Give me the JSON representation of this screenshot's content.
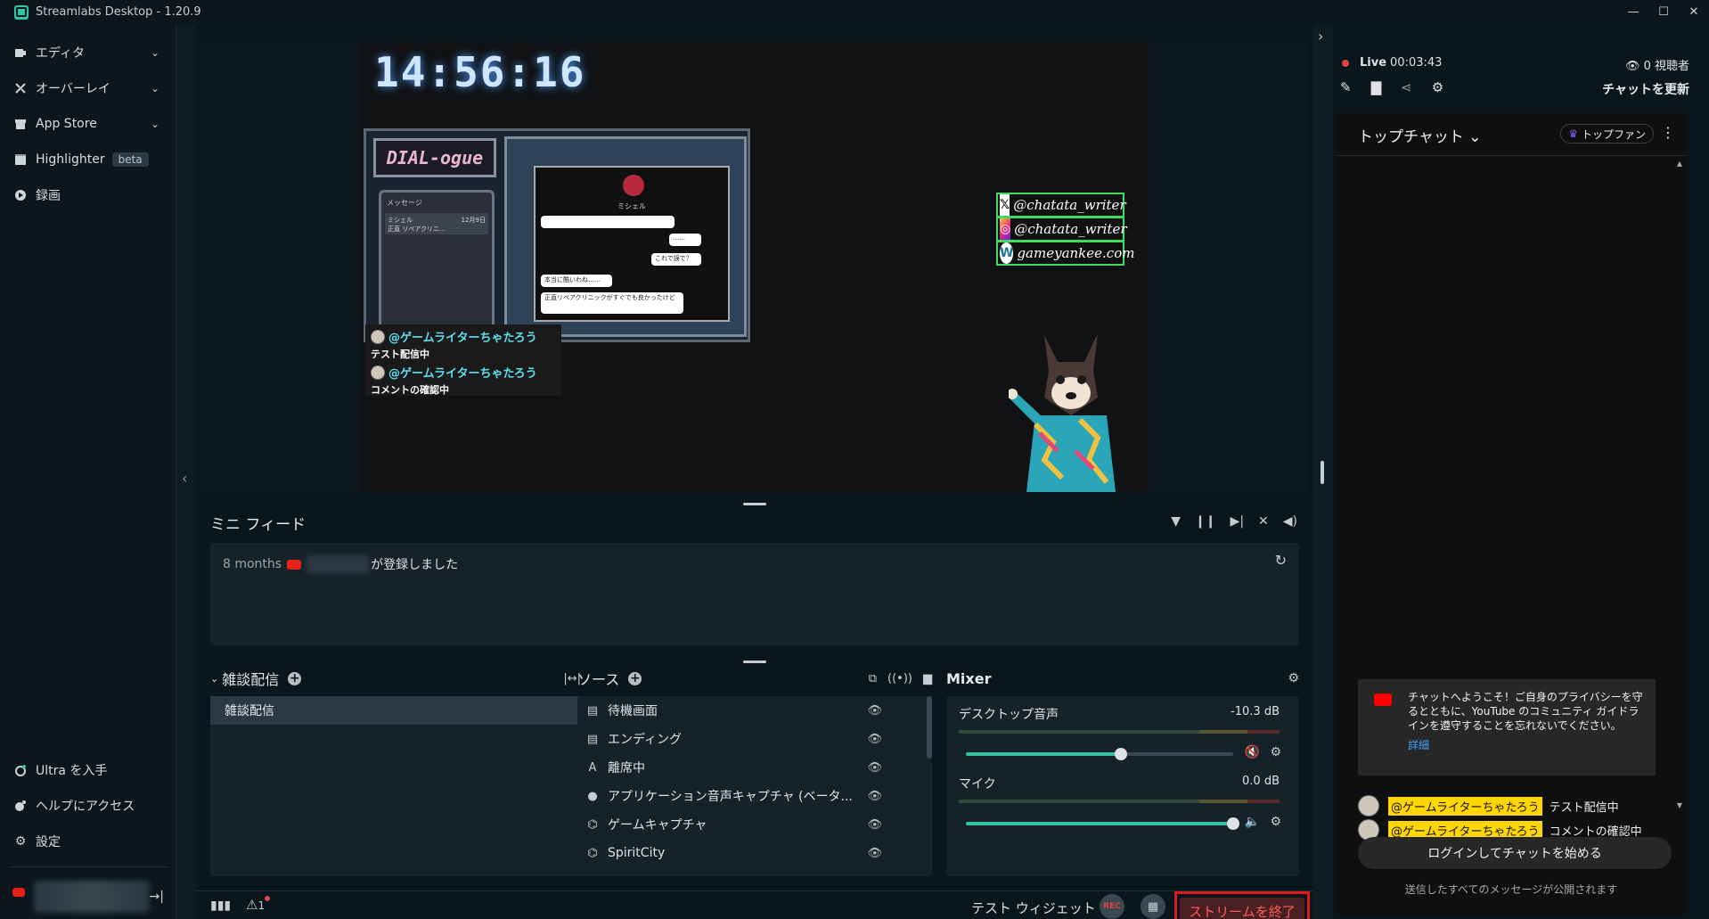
{
  "window": {
    "title": "Streamlabs Desktop - 1.20.9",
    "controls": [
      "—",
      "☐",
      "✕"
    ]
  },
  "sidebar": {
    "items": [
      {
        "label": "エディタ",
        "icon": "editor-icon",
        "chevron": true
      },
      {
        "label": "オーバーレイ",
        "icon": "overlay-icon",
        "chevron": true
      },
      {
        "label": "App Store",
        "icon": "store-icon",
        "chevron": true
      },
      {
        "label": "Highlighter",
        "icon": "highlighter-icon",
        "badge": "beta"
      },
      {
        "label": "録画",
        "icon": "record-icon"
      }
    ],
    "bottom": [
      {
        "label": "Ultra を入手",
        "icon": "ultra-icon"
      },
      {
        "label": "ヘルプにアクセス",
        "icon": "help-icon"
      },
      {
        "label": "設定",
        "icon": "gear-icon"
      }
    ]
  },
  "preview": {
    "clock": "14:56:16",
    "game_title": "DIAL-ogue",
    "phone_header": "メッセージ",
    "phone_sender": "ミシェル",
    "phone_date": "12月9日",
    "phone_preview": "正直 リペアクリニ...",
    "chat_name": "ミシェル",
    "bubbles": [
      "……",
      "これで誤で？",
      "本当に酷いわね……",
      "正直リペアクリニックがすぐでも良かったけど"
    ],
    "overlay_messages": [
      {
        "user": "@ゲームライターちゃたろう",
        "text": "テスト配信中"
      },
      {
        "user": "@ゲームライターちゃたろう",
        "text": "コメントの確認中"
      }
    ],
    "socials": [
      {
        "icon": "x-icon",
        "glyph": "𝕏",
        "text": "@chatata_writer"
      },
      {
        "icon": "instagram-icon",
        "glyph": "◎",
        "text": "@chatata_writer"
      },
      {
        "icon": "wordpress-icon",
        "glyph": "W",
        "text": "gameyankee.com"
      }
    ]
  },
  "mini_feed": {
    "title": "ミニ フィード",
    "entry_time": "8 months",
    "entry_text": "が登録しました"
  },
  "scenes": {
    "title": "雑談配信",
    "items": [
      "雑談配信"
    ]
  },
  "sources": {
    "title": "ソース",
    "items": [
      {
        "label": "待機画面",
        "icon": "file-icon",
        "glyph": "▤"
      },
      {
        "label": "エンディング",
        "icon": "file-icon",
        "glyph": "▤"
      },
      {
        "label": "離席中",
        "icon": "text-icon",
        "glyph": "A"
      },
      {
        "label": "アプリケーション音声キャプチャ (ベータ...",
        "icon": "user-icon",
        "glyph": "●"
      },
      {
        "label": "ゲームキャプチャ",
        "icon": "gamepad-icon",
        "glyph": "⌬"
      },
      {
        "label": "SpiritCity",
        "icon": "gamepad-icon",
        "glyph": "⌬"
      }
    ]
  },
  "mixer": {
    "title": "Mixer",
    "channels": [
      {
        "name": "デスクトップ音声",
        "db": "-10.3 dB",
        "level": 0.58
      },
      {
        "name": "マイク",
        "db": "0.0 dB",
        "level": 1.0
      }
    ]
  },
  "bottombar": {
    "test_widget": "テスト ウィジェット",
    "rec": "REC",
    "end_stream": "ストリームを終了",
    "alert_count": "1"
  },
  "chat": {
    "live_label": "Live",
    "live_time": "00:03:43",
    "viewers": "0 視聴者",
    "refresh": "チャットを更新",
    "top_chat": "トップチャット",
    "top_fan": "トップファン",
    "welcome": "チャットへようこそ！ご自身のプライバシーを守るとともに、YouTube のコミュニティ ガイドラインを遵守することを忘れないでください。",
    "welcome_link": "詳細",
    "messages": [
      {
        "user": "@ゲームライターちゃたろう",
        "text": "テスト配信中"
      },
      {
        "user": "@ゲームライターちゃたろう",
        "text": "コメントの確認中"
      }
    ],
    "login": "ログインしてチャットを始める",
    "note": "送信したすべてのメッセージが公開されます"
  }
}
